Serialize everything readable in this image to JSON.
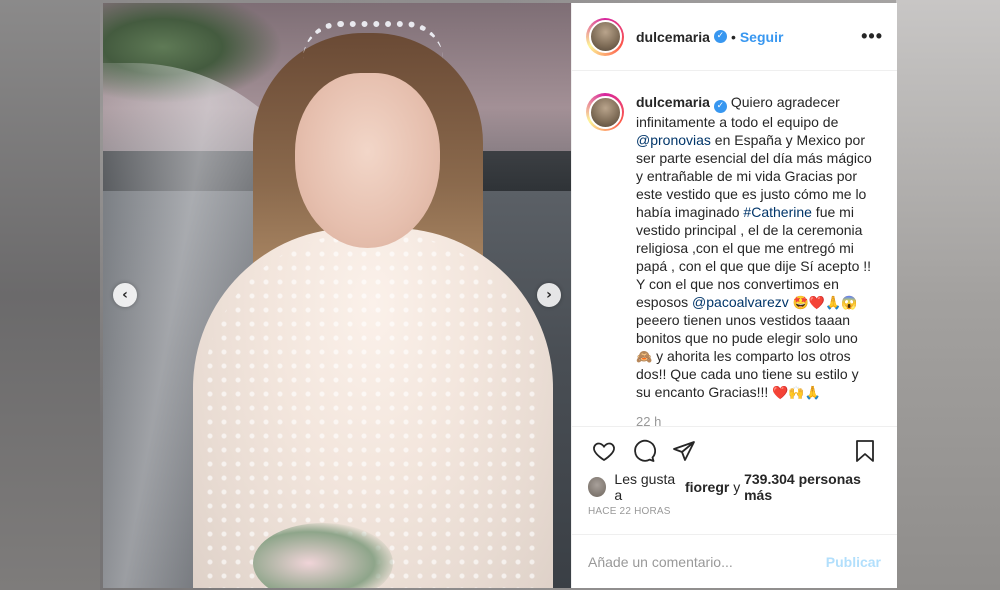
{
  "post": {
    "username": "dulcemaria",
    "verified_icon": "verified-badge-icon",
    "dot": "•",
    "follow_label": "Seguir",
    "more_label": "•••"
  },
  "caption": {
    "username": "dulcemaria",
    "t1": " Quiero agradecer infinitamente a todo el equipo de ",
    "mention1": "@pronovias",
    "t2": " en España y Mexico por ser parte esencial del día más mágico y entrañable de mi vida Gracias por este vestido que es justo cómo me lo había imaginado ",
    "hashtag": "#Catherine",
    "t3": " fue mi vestido principal , el de la ceremonia religiosa ,con el que me entregó mi papá , con el que que dije Sí acepto !! Y con el que nos convertimos en esposos ",
    "mention2": "@pacoalvarezv",
    "emoji1": "🤩❤️🙏😱",
    "t4": " peeero tienen unos vestidos taaan bonitos que no pude elegir solo uno ",
    "emoji2": "🙈",
    "t5": " y ahorita les comparto los otros dos!! Que cada uno tiene su estilo y su encanto Gracias!!! ",
    "emoji3": "❤️🙌🙏",
    "time": "22 h"
  },
  "likes": {
    "prefix": "Les gusta a ",
    "user": "fioregr",
    "middle": " y ",
    "count": "739.304 personas más"
  },
  "timestamp": "HACE 22 HORAS",
  "comment_box": {
    "placeholder": "Añade un comentario...",
    "publish_label": "Publicar"
  },
  "carousel": {
    "prev_label": "‹",
    "next_label": "›"
  },
  "colors": {
    "accent": "#3897f0",
    "link": "#003569",
    "muted": "#999999",
    "publish_disabled": "#b2dffc"
  }
}
